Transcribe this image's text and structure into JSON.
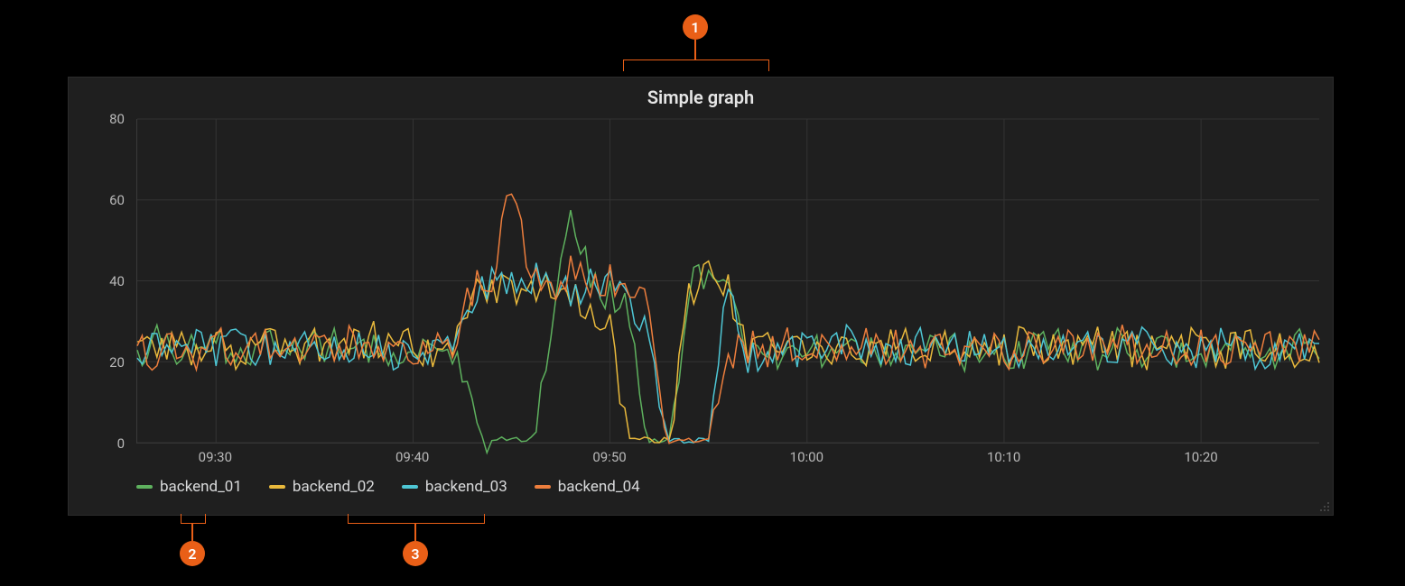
{
  "panel": {
    "title": "Simple graph"
  },
  "callouts": {
    "one": "1",
    "two": "2",
    "three": "3"
  },
  "colors": {
    "backend_01": "#5eb15e",
    "backend_02": "#e9b93c",
    "backend_03": "#4ec6d4",
    "backend_04": "#ed7e3d",
    "accent": "#e95f17"
  },
  "chart_data": {
    "type": "line",
    "title": "Simple graph",
    "xlabel": "",
    "ylabel": "",
    "ylim": [
      0,
      80
    ],
    "x_tick_labels": [
      "09:30",
      "09:40",
      "09:50",
      "10:00",
      "10:10",
      "10:20"
    ],
    "x_range_minutes": [
      26,
      86
    ],
    "legend_position": "bottom",
    "grid": true,
    "x": [
      26,
      27,
      28,
      29,
      30,
      31,
      32,
      33,
      34,
      35,
      36,
      37,
      38,
      39,
      40,
      41,
      42,
      43,
      44,
      45,
      46,
      47,
      48,
      49,
      50,
      51,
      52,
      53,
      54,
      55,
      56,
      57,
      58,
      59,
      60,
      61,
      62,
      63,
      64,
      65,
      66,
      67,
      68,
      69,
      70,
      71,
      72,
      73,
      74,
      75,
      76,
      77,
      78,
      79,
      80,
      81,
      82,
      83,
      84,
      85,
      86
    ],
    "series": [
      {
        "name": "backend_01",
        "color": "#5eb15e",
        "values": [
          25,
          27,
          24,
          26,
          28,
          23,
          26,
          27,
          25,
          26,
          27,
          24,
          26,
          25,
          27,
          26,
          24,
          10,
          1,
          1,
          1,
          32,
          60,
          43,
          38,
          35,
          1,
          1,
          41,
          44,
          42,
          22,
          25,
          24,
          26,
          25,
          27,
          24,
          26,
          23,
          25,
          27,
          24,
          26,
          25,
          23,
          27,
          26,
          25,
          24,
          27,
          25,
          26,
          24,
          23,
          27,
          25,
          26,
          24,
          27,
          25
        ]
      },
      {
        "name": "backend_02",
        "color": "#e9b93c",
        "values": [
          27,
          24,
          26,
          25,
          27,
          24,
          28,
          26,
          25,
          27,
          24,
          26,
          28,
          25,
          27,
          24,
          26,
          38,
          41,
          39,
          42,
          40,
          38,
          36,
          30,
          1,
          1,
          1,
          40,
          43,
          41,
          23,
          26,
          25,
          27,
          24,
          26,
          25,
          28,
          26,
          25,
          27,
          24,
          26,
          25,
          27,
          24,
          26,
          25,
          27,
          26,
          24,
          25,
          27,
          26,
          24,
          27,
          25,
          26,
          24,
          26
        ]
      },
      {
        "name": "backend_03",
        "color": "#4ec6d4",
        "values": [
          23,
          26,
          25,
          27,
          24,
          28,
          25,
          26,
          27,
          24,
          26,
          25,
          27,
          24,
          26,
          25,
          27,
          36,
          42,
          40,
          43,
          41,
          39,
          42,
          41,
          38,
          28,
          1,
          1,
          1,
          43,
          22,
          25,
          24,
          26,
          25,
          27,
          24,
          26,
          25,
          27,
          24,
          26,
          25,
          27,
          24,
          26,
          25,
          27,
          24,
          25,
          27,
          26,
          24,
          25,
          27,
          26,
          24,
          25,
          27,
          24
        ]
      },
      {
        "name": "backend_04",
        "color": "#ed7e3d",
        "values": [
          26,
          23,
          27,
          24,
          28,
          25,
          26,
          27,
          24,
          26,
          25,
          28,
          25,
          27,
          24,
          26,
          25,
          40,
          43,
          67,
          42,
          40,
          44,
          41,
          43,
          40,
          38,
          1,
          1,
          1,
          24,
          26,
          25,
          27,
          24,
          26,
          25,
          28,
          25,
          27,
          24,
          26,
          25,
          27,
          24,
          26,
          25,
          27,
          24,
          26,
          28,
          25,
          27,
          24,
          26,
          25,
          28,
          24,
          27,
          25,
          27
        ]
      }
    ]
  }
}
